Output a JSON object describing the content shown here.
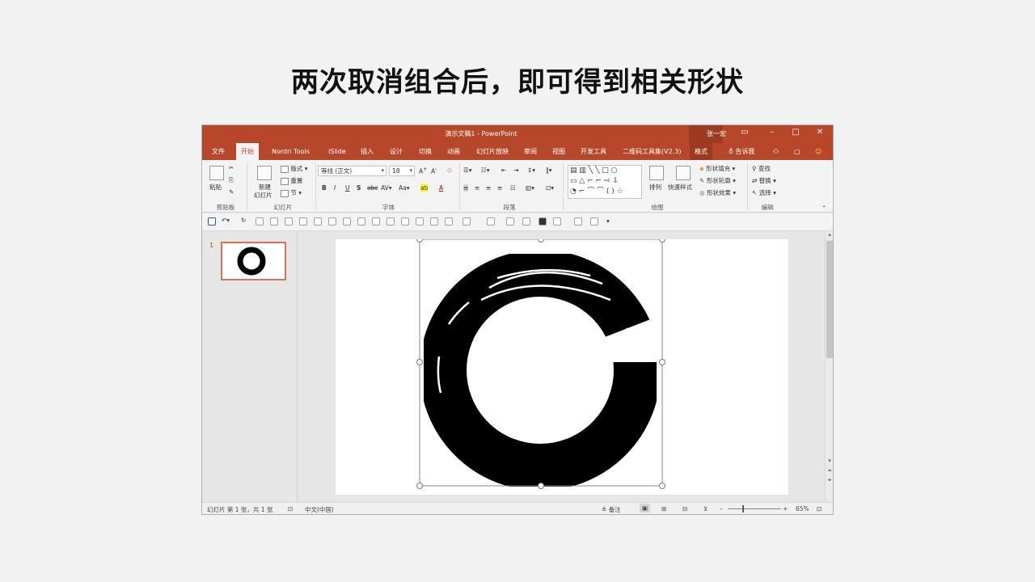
{
  "heading": "两次取消组合后，即可得到相关形状",
  "app": {
    "title": "演示文稿1 - PowerPoint",
    "user": "张一宏",
    "tabs": [
      "文件",
      "开始",
      "Nordri Tools",
      "iSlide",
      "插入",
      "设计",
      "切换",
      "动画",
      "幻灯片放映",
      "审阅",
      "视图",
      "开发工具",
      "二维码工具集(V2.3)",
      "格式"
    ],
    "tell_me": "告诉我"
  },
  "ribbon": {
    "clipboard": {
      "paste": "粘贴",
      "label": "剪贴板"
    },
    "slides": {
      "new_slide_1": "新建",
      "new_slide_2": "幻灯片",
      "layout": "版式",
      "reset": "重置",
      "section": "节",
      "label": "幻灯片"
    },
    "font": {
      "font_name": "等线 (正文)",
      "font_size": "18",
      "label": "字体"
    },
    "paragraph": {
      "label": "段落"
    },
    "drawing": {
      "arrange": "排列",
      "quick_styles": "快速样式",
      "fill": "形状填充",
      "outline": "形状轮廓",
      "effects": "形状效果",
      "label": "绘图"
    },
    "editing": {
      "find": "查找",
      "replace": "替换",
      "select": "选择",
      "label": "编辑"
    }
  },
  "thumbnails": [
    {
      "number": "1"
    }
  ],
  "status": {
    "slide_info": "幻灯片 第 1 张，共 1 张",
    "language": "中文(中国)",
    "notes": "备注",
    "zoom": "65%"
  }
}
